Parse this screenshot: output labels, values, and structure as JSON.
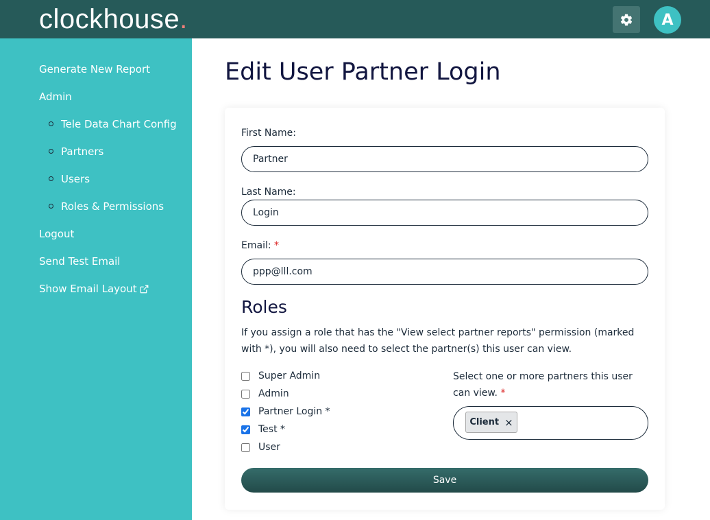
{
  "header": {
    "logo_text": "clockhouse",
    "logo_dot": ".",
    "avatar_letter": "A",
    "accent_color": "#f07f7a"
  },
  "sidebar": {
    "items": [
      {
        "label": "Generate New Report"
      },
      {
        "label": "Admin"
      },
      {
        "label": "Tele Data Chart Config"
      },
      {
        "label": "Partners"
      },
      {
        "label": "Users"
      },
      {
        "label": "Roles & Permissions"
      },
      {
        "label": "Logout"
      },
      {
        "label": "Send Test Email"
      },
      {
        "label": "Show Email Layout"
      }
    ]
  },
  "page": {
    "title": "Edit User Partner Login"
  },
  "form": {
    "first_name_label": "First Name:",
    "first_name_value": "Partner",
    "last_name_label": "Last Name:",
    "last_name_value": "Login",
    "email_label": "Email:",
    "email_value": "ppp@lll.com",
    "required_marker": "*"
  },
  "roles": {
    "heading": "Roles",
    "description": "If you assign a role that has the \"View select partner reports\" permission (marked with *), you will also need to select the partner(s) this user can view.",
    "items": [
      {
        "label": "Super Admin",
        "checked": false
      },
      {
        "label": "Admin",
        "checked": false
      },
      {
        "label": "Partner Login *",
        "checked": true
      },
      {
        "label": "Test *",
        "checked": true
      },
      {
        "label": "User",
        "checked": false
      }
    ],
    "partners_label": "Select one or more partners this user can view.",
    "selected_partners": [
      "Client"
    ],
    "remove_glyph": "×"
  },
  "actions": {
    "save_label": "Save"
  }
}
